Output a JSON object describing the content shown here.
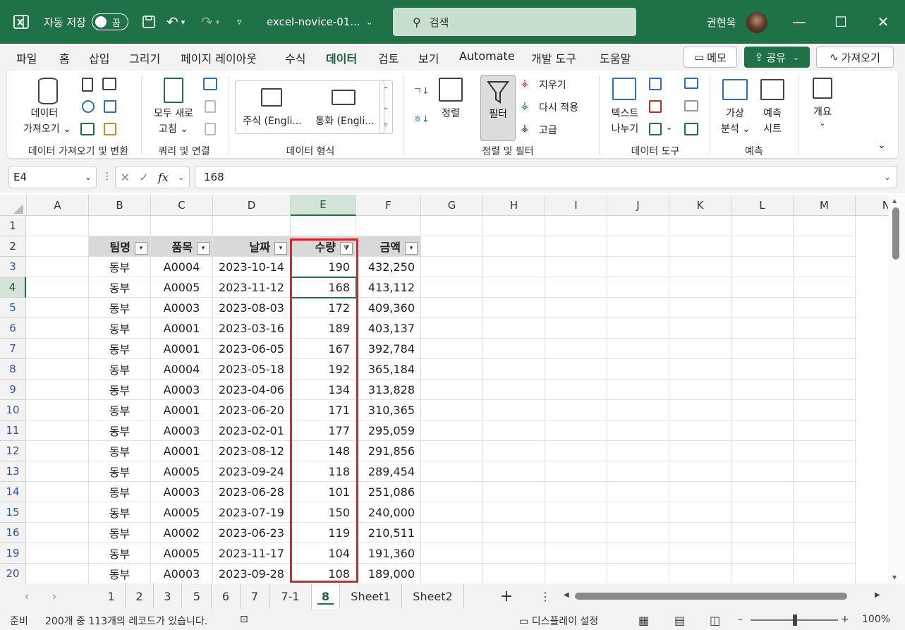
{
  "app": {
    "autosave_label": "자동 저장",
    "autosave_state": "끔",
    "file_name": "excel-novice-01...",
    "search_placeholder": "검색",
    "user_name": "권현욱",
    "accent_color": "#1f7246"
  },
  "menu": {
    "items": [
      "파일",
      "홈",
      "삽입",
      "그리기",
      "페이지 레이아웃",
      "수식",
      "데이터",
      "검토",
      "보기",
      "Automate",
      "개발 도구",
      "도움말"
    ],
    "active": "데이터",
    "memo_label": "메모",
    "share_label": "공유",
    "get_label": "가져오기"
  },
  "ribbon": {
    "get_data_label": "데이터",
    "get_data_label2": "가져오기",
    "refresh_all_label": "모두 새로",
    "refresh_all_label2": "고침",
    "stocks_label": "주식 (Engli...",
    "currency_label": "통화 (Engli...",
    "sort_label": "정렬",
    "filter_label": "필터",
    "clear_label": "지우기",
    "reapply_label": "다시 적용",
    "advanced_label": "고급",
    "text_to_columns_label": "텍스트",
    "text_to_columns_label2": "나누기",
    "whatif_label": "가상",
    "whatif_label2": "분석",
    "forecast_label": "예측",
    "forecast_label2": "시트",
    "outline_label": "개요",
    "groups": {
      "get_transform": "데이터 가져오기 및 변환",
      "queries": "쿼리 및 연결",
      "data_types": "데이터 형식",
      "sort_filter": "정렬 및 필터",
      "data_tools": "데이터 도구",
      "forecast": "예측"
    }
  },
  "formula": {
    "name_box": "E4",
    "fx": "fx",
    "value": "168"
  },
  "columns": [
    "A",
    "B",
    "C",
    "D",
    "E",
    "F",
    "G",
    "H",
    "I",
    "J",
    "K",
    "L",
    "M",
    "N"
  ],
  "selected_column": "E",
  "table": {
    "headers": [
      "팀명",
      "품목",
      "날짜",
      "수량",
      "금액"
    ],
    "filtered_column": "수량",
    "rows": [
      {
        "row": "3",
        "team": "동부",
        "item": "A0004",
        "date": "2023-10-14",
        "qty": "190",
        "amount": "432,250"
      },
      {
        "row": "4",
        "team": "동부",
        "item": "A0005",
        "date": "2023-11-12",
        "qty": "168",
        "amount": "413,112"
      },
      {
        "row": "5",
        "team": "동부",
        "item": "A0003",
        "date": "2023-08-03",
        "qty": "172",
        "amount": "409,360"
      },
      {
        "row": "6",
        "team": "동부",
        "item": "A0001",
        "date": "2023-03-16",
        "qty": "189",
        "amount": "403,137"
      },
      {
        "row": "7",
        "team": "동부",
        "item": "A0001",
        "date": "2023-06-05",
        "qty": "167",
        "amount": "392,784"
      },
      {
        "row": "8",
        "team": "동부",
        "item": "A0004",
        "date": "2023-05-18",
        "qty": "192",
        "amount": "365,184"
      },
      {
        "row": "9",
        "team": "동부",
        "item": "A0003",
        "date": "2023-04-06",
        "qty": "134",
        "amount": "313,828"
      },
      {
        "row": "10",
        "team": "동부",
        "item": "A0001",
        "date": "2023-06-20",
        "qty": "171",
        "amount": "310,365"
      },
      {
        "row": "11",
        "team": "동부",
        "item": "A0003",
        "date": "2023-02-01",
        "qty": "177",
        "amount": "295,059"
      },
      {
        "row": "12",
        "team": "동부",
        "item": "A0001",
        "date": "2023-08-12",
        "qty": "148",
        "amount": "291,856"
      },
      {
        "row": "13",
        "team": "동부",
        "item": "A0005",
        "date": "2023-09-24",
        "qty": "118",
        "amount": "289,454"
      },
      {
        "row": "14",
        "team": "동부",
        "item": "A0003",
        "date": "2023-06-28",
        "qty": "101",
        "amount": "251,086"
      },
      {
        "row": "15",
        "team": "동부",
        "item": "A0005",
        "date": "2023-07-19",
        "qty": "150",
        "amount": "240,000"
      },
      {
        "row": "16",
        "team": "동부",
        "item": "A0002",
        "date": "2023-06-23",
        "qty": "119",
        "amount": "210,511"
      },
      {
        "row": "19",
        "team": "동부",
        "item": "A0005",
        "date": "2023-11-17",
        "qty": "104",
        "amount": "191,360"
      },
      {
        "row": "20",
        "team": "동부",
        "item": "A0003",
        "date": "2023-09-28",
        "qty": "108",
        "amount": "189,000"
      }
    ]
  },
  "sheets": {
    "tabs": [
      "1",
      "2",
      "3",
      "5",
      "6",
      "7",
      "7-1",
      "8",
      "Sheet1",
      "Sheet2"
    ],
    "active": "8"
  },
  "status": {
    "ready": "준비",
    "record_info": "200개 중 113개의 레코드가 있습니다.",
    "display_settings": "디스플레이 설정",
    "zoom": "100%"
  }
}
